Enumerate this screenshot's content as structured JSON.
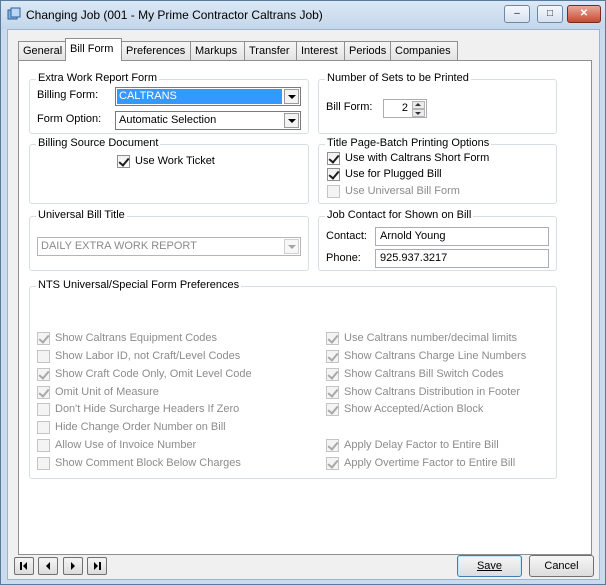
{
  "window": {
    "title": "Changing Job  (001 - My Prime Contractor Caltrans Job)",
    "icon": "app-window-icon",
    "controls": {
      "minimize": "–",
      "maximize": "□",
      "close": "✕"
    }
  },
  "tabs": [
    {
      "label": "General"
    },
    {
      "label": "Bill Form"
    },
    {
      "label": "Preferences"
    },
    {
      "label": "Markups"
    },
    {
      "label": "Transfer"
    },
    {
      "label": "Interest"
    },
    {
      "label": "Periods"
    },
    {
      "label": "Companies"
    }
  ],
  "active_tab": "Bill Form",
  "extra_work": {
    "title": "Extra Work Report Form",
    "billing_form_label": "Billing Form:",
    "billing_form_value": "CALTRANS",
    "form_option_label": "Form Option:",
    "form_option_value": "Automatic Selection"
  },
  "sets": {
    "title": "Number of Sets to be Printed",
    "bill_form_label": "Bill Form:",
    "bill_form_value": "2"
  },
  "billing_source": {
    "title": "Billing Source Document",
    "use_work_ticket": {
      "label": "Use Work Ticket",
      "checked": true
    }
  },
  "title_page": {
    "title": "Title Page-Batch Printing Options",
    "items": [
      {
        "label": "Use with Caltrans Short Form",
        "checked": true,
        "enabled": true
      },
      {
        "label": "Use for Plugged Bill",
        "checked": true,
        "enabled": true
      },
      {
        "label": "Use Universal Bill Form",
        "checked": false,
        "enabled": false
      }
    ]
  },
  "universal_title": {
    "title": "Universal Bill Title",
    "value": "DAILY EXTRA WORK REPORT"
  },
  "job_contact": {
    "title": "Job Contact for Shown on Bill",
    "contact_label": "Contact:",
    "contact_value": "Arnold Young",
    "phone_label": "Phone:",
    "phone_value": "925.937.3217"
  },
  "nts": {
    "title": "NTS Universal/Special Form Preferences",
    "left": [
      {
        "label": "Show Caltrans Equipment Codes",
        "checked": true
      },
      {
        "label": "Show Labor ID, not Craft/Level Codes",
        "checked": false
      },
      {
        "label": "Show Craft Code Only, Omit Level Code",
        "checked": true
      },
      {
        "label": "Omit Unit of Measure",
        "checked": true
      },
      {
        "label": "Don't Hide Surcharge Headers If Zero",
        "checked": false
      },
      {
        "label": "Hide Change Order Number on Bill",
        "checked": false
      },
      {
        "label": "Allow Use of Invoice Number",
        "checked": false
      },
      {
        "label": "Show Comment Block Below Charges",
        "checked": false
      }
    ],
    "right": [
      {
        "label": "Use Caltrans number/decimal limits",
        "checked": true
      },
      {
        "label": "Show Caltrans Charge Line Numbers",
        "checked": true
      },
      {
        "label": "Show Caltrans Bill Switch Codes",
        "checked": true
      },
      {
        "label": "Show Caltrans Distribution in Footer",
        "checked": true
      },
      {
        "label": "Show Accepted/Action Block",
        "checked": true
      },
      {
        "label": "Apply Delay Factor to Entire Bill",
        "checked": true
      },
      {
        "label": "Apply Overtime Factor to Entire Bill",
        "checked": true
      }
    ]
  },
  "footer": {
    "nav": [
      "first-record-icon",
      "previous-record-icon",
      "next-record-icon",
      "last-record-icon"
    ],
    "save": "Save",
    "cancel": "Cancel"
  }
}
